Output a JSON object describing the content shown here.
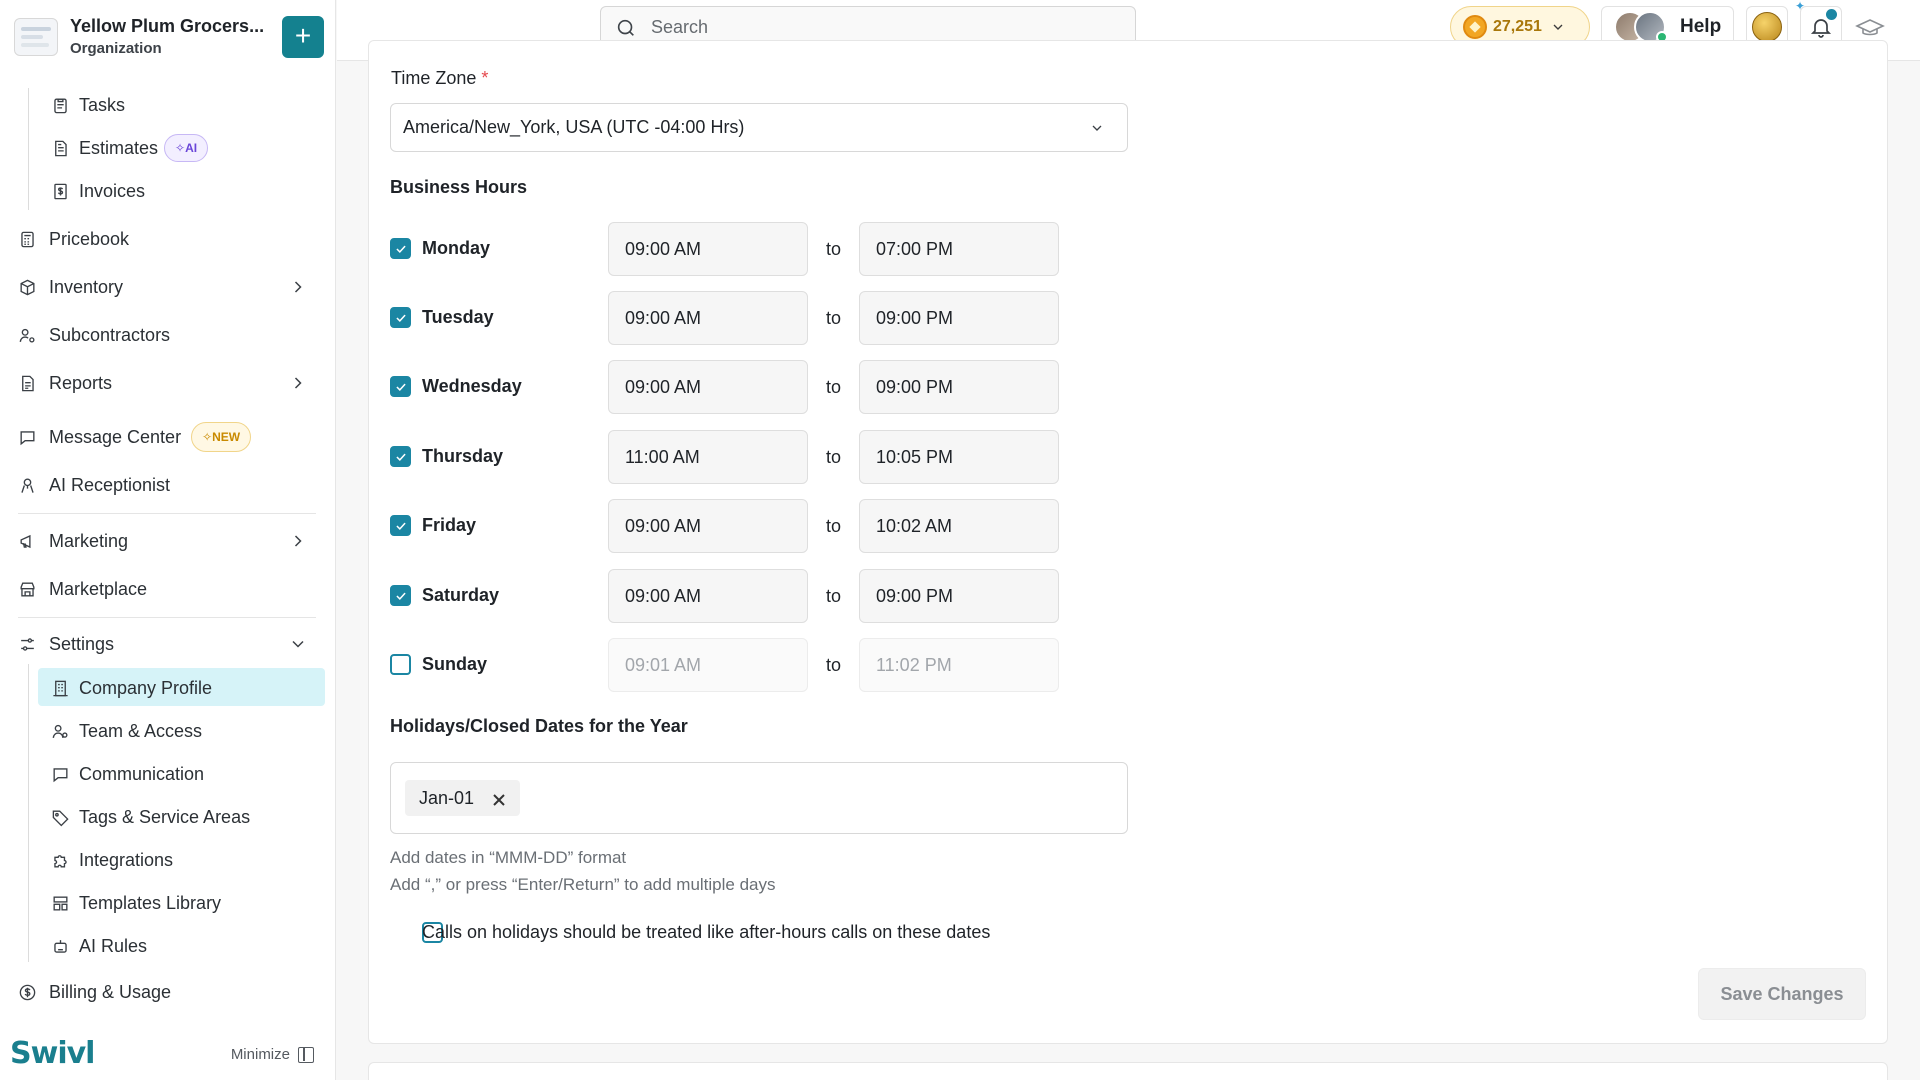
{
  "org": {
    "name": "Yellow Plum Grocers...",
    "subtitle": "Organization",
    "add_label": "+"
  },
  "sidebar": {
    "items": [
      {
        "label": "Tasks"
      },
      {
        "label": "Estimates",
        "badge": "AI"
      },
      {
        "label": "Invoices"
      },
      {
        "label": "Pricebook"
      },
      {
        "label": "Inventory"
      },
      {
        "label": "Subcontractors"
      },
      {
        "label": "Reports"
      },
      {
        "label": "Message Center",
        "badge": "NEW"
      },
      {
        "label": "AI Receptionist"
      },
      {
        "label": "Marketing"
      },
      {
        "label": "Marketplace"
      },
      {
        "label": "Settings"
      },
      {
        "label": "Company Profile"
      },
      {
        "label": "Team & Access"
      },
      {
        "label": "Communication"
      },
      {
        "label": "Tags & Service Areas"
      },
      {
        "label": "Integrations"
      },
      {
        "label": "Templates Library"
      },
      {
        "label": "AI Rules"
      },
      {
        "label": "Billing & Usage"
      }
    ],
    "active": "Company Profile",
    "brand": "Swivl",
    "minimize_label": "Minimize"
  },
  "topbar": {
    "search_placeholder": "Search",
    "credits": "27,251",
    "help_label": "Help"
  },
  "form": {
    "timezone_label": "Time Zone",
    "required_mark": "*",
    "timezone_value": "America/New_York, USA (UTC -04:00 Hrs)",
    "business_hours_title": "Business Hours",
    "to_label": "to",
    "days": [
      {
        "name": "Monday",
        "checked": true,
        "from": "09:00 AM",
        "to": "07:00 PM"
      },
      {
        "name": "Tuesday",
        "checked": true,
        "from": "09:00 AM",
        "to": "09:00 PM"
      },
      {
        "name": "Wednesday",
        "checked": true,
        "from": "09:00 AM",
        "to": "09:00 PM"
      },
      {
        "name": "Thursday",
        "checked": true,
        "from": "11:00 AM",
        "to": "10:05 PM"
      },
      {
        "name": "Friday",
        "checked": true,
        "from": "09:00 AM",
        "to": "10:02 AM"
      },
      {
        "name": "Saturday",
        "checked": true,
        "from": "09:00 AM",
        "to": "09:00 PM"
      },
      {
        "name": "Sunday",
        "checked": false,
        "from": "09:01 AM",
        "to": "11:02 PM"
      }
    ],
    "holidays_title": "Holidays/Closed Dates for the Year",
    "holidays": [
      "Jan-01"
    ],
    "hint1": "Add dates in “MMM-DD” format",
    "hint2": "Add “,” or press “Enter/Return” to add multiple days",
    "calls_label": "Calls on holidays should be treated like after-hours calls on these dates",
    "save_label": "Save Changes"
  },
  "colors": {
    "accent": "#1b86a3",
    "add_button": "#14818f",
    "active_nav_bg": "#d6f3f8",
    "required": "#e5484d"
  }
}
